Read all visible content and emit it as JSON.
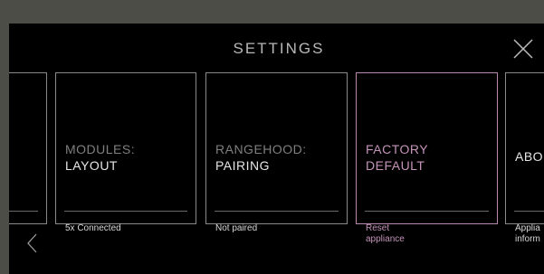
{
  "header": {
    "title": "SETTINGS"
  },
  "icons": {
    "close": "close-icon",
    "back": "chevron-left-icon"
  },
  "colors": {
    "accent": "#c493b9",
    "card_border": "#8a8a8a",
    "background": "#000000"
  },
  "cards": [
    {
      "line1": "MODULES:",
      "line2": "LAYOUT",
      "sub": "5x Connected",
      "sub2": ""
    },
    {
      "line1": "RANGEHOOD:",
      "line2": "PAIRING",
      "sub": "Not paired",
      "sub2": ""
    },
    {
      "line1": "FACTORY",
      "line2": "DEFAULT",
      "sub": "Reset",
      "sub2": "appliance"
    },
    {
      "line1": "",
      "line2": "ABO",
      "sub": "Applia",
      "sub2": "inform"
    }
  ]
}
